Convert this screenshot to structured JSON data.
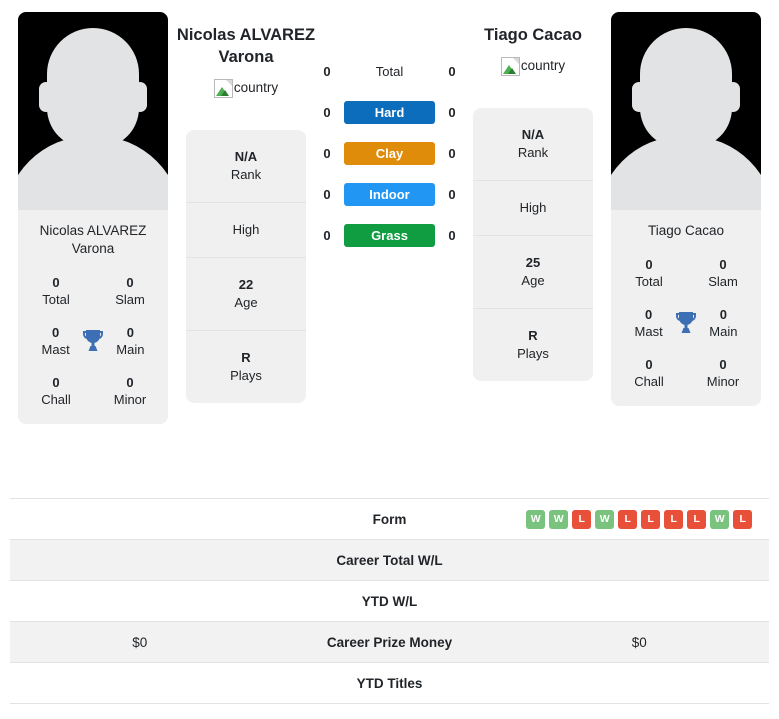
{
  "players": {
    "left": {
      "full_name": "Nicolas ALVAREZ Varona",
      "name_line1": "Nicolas ALVAREZ",
      "name_line2": "Varona",
      "country_alt": "country",
      "card_name": "Nicolas ALVAREZ Varona",
      "titles": {
        "total_value": "0",
        "total_label": "Total",
        "slam_value": "0",
        "slam_label": "Slam",
        "mast_value": "0",
        "mast_label": "Mast",
        "main_value": "0",
        "main_label": "Main",
        "chall_value": "0",
        "chall_label": "Chall",
        "minor_value": "0",
        "minor_label": "Minor"
      },
      "rank": {
        "rank_value": "N/A",
        "rank_label": "Rank",
        "high_label": "High",
        "age_value": "22",
        "age_label": "Age",
        "plays_value": "R",
        "plays_label": "Plays"
      },
      "surfaces": {
        "total": "0",
        "hard": "0",
        "clay": "0",
        "indoor": "0",
        "grass": "0"
      },
      "career_prize_money": "$0",
      "career_total_wl": "",
      "ytd_wl": "",
      "ytd_titles": ""
    },
    "right": {
      "full_name": "Tiago Cacao",
      "name_line1": "Tiago Cacao",
      "name_line2": "",
      "country_alt": "country",
      "card_name": "Tiago Cacao",
      "titles": {
        "total_value": "0",
        "total_label": "Total",
        "slam_value": "0",
        "slam_label": "Slam",
        "mast_value": "0",
        "mast_label": "Mast",
        "main_value": "0",
        "main_label": "Main",
        "chall_value": "0",
        "chall_label": "Chall",
        "minor_value": "0",
        "minor_label": "Minor"
      },
      "rank": {
        "rank_value": "N/A",
        "rank_label": "Rank",
        "high_label": "High",
        "age_value": "25",
        "age_label": "Age",
        "plays_value": "R",
        "plays_label": "Plays"
      },
      "surfaces": {
        "total": "0",
        "hard": "0",
        "clay": "0",
        "indoor": "0",
        "grass": "0"
      },
      "career_prize_money": "$0",
      "career_total_wl": "",
      "ytd_wl": "",
      "ytd_titles": ""
    }
  },
  "surface_labels": {
    "total": "Total",
    "hard": "Hard",
    "clay": "Clay",
    "indoor": "Indoor",
    "grass": "Grass"
  },
  "surface_colors": {
    "hard": "#0d6dbd",
    "clay": "#e08c0b",
    "indoor": "#2196f3",
    "grass": "#109c41"
  },
  "table": {
    "form_label": "Form",
    "career_total_wl_label": "Career Total W/L",
    "ytd_wl_label": "YTD W/L",
    "career_prize_money_label": "Career Prize Money",
    "ytd_titles_label": "YTD Titles"
  },
  "form": {
    "results": [
      "W",
      "W",
      "L",
      "W",
      "L",
      "L",
      "L",
      "L",
      "W",
      "L"
    ]
  },
  "colors": {
    "win": "#79c37e",
    "loss": "#e8503a",
    "trophy": "#3d6fb4",
    "panel_bg": "#f0f0f0",
    "row_shade": "#f2f2f2"
  }
}
